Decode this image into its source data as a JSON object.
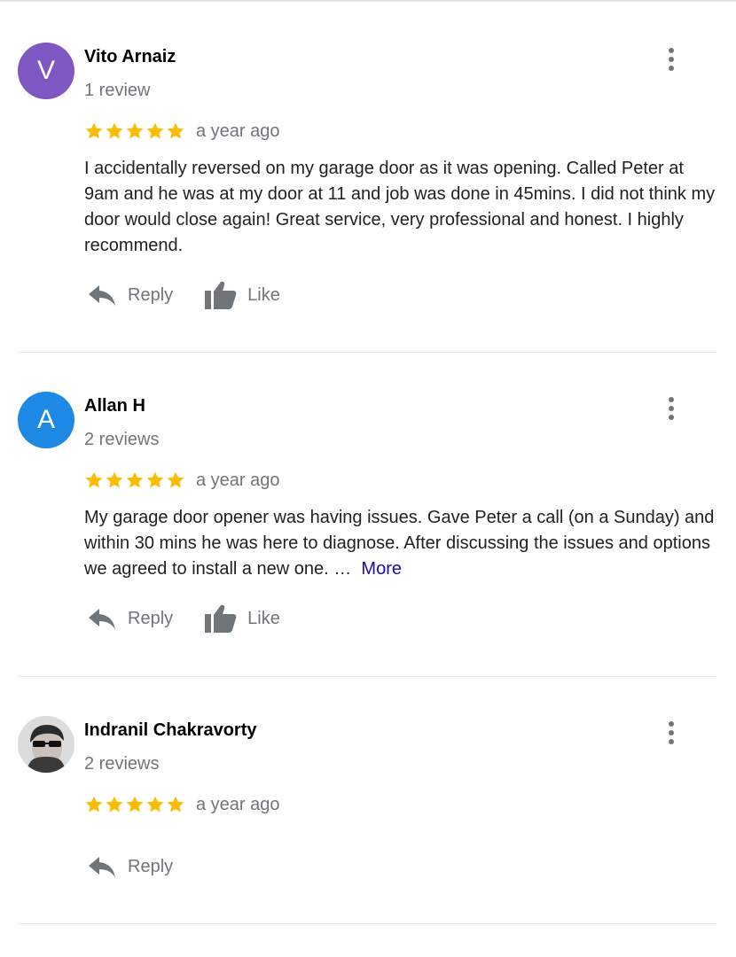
{
  "reviews": [
    {
      "avatar_letter": "V",
      "avatar_color": "#7e57c2",
      "name": "Vito Arnaiz",
      "review_count": "1 review",
      "stars": 5,
      "time": "a year ago",
      "text": "I accidentally reversed on my garage door as it was opening. Called Peter at 9am and he was at my door at 11 and job was done in 45mins. I did not think my door would close again! Great service, very professional and honest. I highly recommend.",
      "reply_label": "Reply",
      "like_label": "Like"
    },
    {
      "avatar_letter": "A",
      "avatar_color": "#1e88e5",
      "name": "Allan H",
      "review_count": "2 reviews",
      "stars": 5,
      "time": "a year ago",
      "text": "My garage door opener was having issues. Gave Peter a call (on a Sunday) and within 30 mins he was here to diagnose. After discussing the issues and options we agreed to install a new one. …",
      "more_label": "More",
      "reply_label": "Reply",
      "like_label": "Like"
    },
    {
      "avatar_letter": "",
      "avatar_color": "#5f6368",
      "name": "Indranil Chakravorty",
      "review_count": "2 reviews",
      "stars": 5,
      "time": "a year ago",
      "reply_label": "Reply"
    }
  ],
  "icons": {
    "star": "star-icon",
    "menu": "more-vert-icon",
    "reply": "reply-icon",
    "like": "thumb-up-icon"
  },
  "colors": {
    "star": "#fbbc04",
    "link": "#1a0dab",
    "secondary_text": "#70757a"
  }
}
